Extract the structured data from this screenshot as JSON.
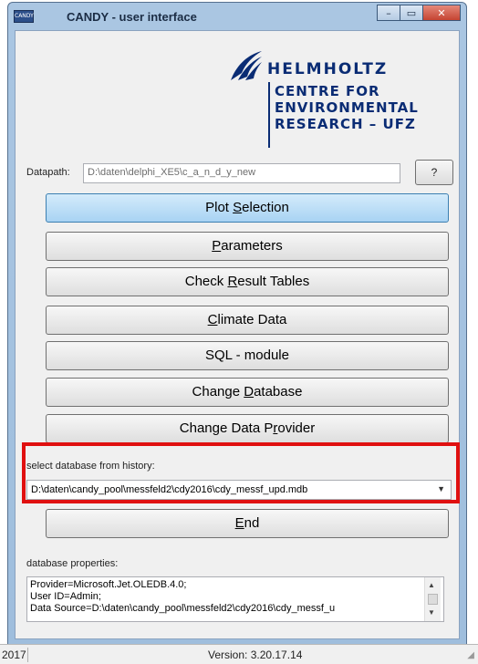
{
  "window": {
    "title": "CANDY  - user interface",
    "app_icon": "CANDY",
    "controls": {
      "minimize": "–",
      "maximize": "▭",
      "close": "✕"
    }
  },
  "logo": {
    "name": "HELMHOLTZ",
    "sub": [
      "CENTRE FOR",
      "ENVIRONMENTAL",
      "RESEARCH – UFZ"
    ],
    "brand_color": "#0a2c74"
  },
  "datapath": {
    "label": "Datapath:",
    "value": "D:\\daten\\delphi_XE5\\c_a_n_d_y_new",
    "help_label": "?"
  },
  "buttons": {
    "plot_selection": {
      "pre": "Plot ",
      "key": "S",
      "post": "election"
    },
    "parameters": {
      "pre": "",
      "key": "P",
      "post": "arameters"
    },
    "check_result_tables": {
      "pre": "Check ",
      "key": "R",
      "post": "esult Tables"
    },
    "climate_data": {
      "pre": "",
      "key": "C",
      "post": "limate Data"
    },
    "sql_module": {
      "pre": "SQL - module",
      "key": "",
      "post": ""
    },
    "change_database": {
      "pre": "Change  ",
      "key": "D",
      "post": "atabase"
    },
    "change_data_provider": {
      "pre": "Change Data P",
      "key": "r",
      "post": "ovider"
    },
    "end": {
      "pre": "",
      "key": "E",
      "post": "nd"
    }
  },
  "history": {
    "label": "select database from history:",
    "selected": "D:\\daten\\candy_pool\\messfeld2\\cdy2016\\cdy_messf_upd.mdb",
    "arrow": "▼"
  },
  "properties": {
    "label": "database properties:",
    "text": "Provider=Microsoft.Jet.OLEDB.4.0;\nUser ID=Admin;\nData Source=D:\\daten\\candy_pool\\messfeld2\\cdy2016\\cdy_messf_u"
  },
  "status": {
    "year": "2017",
    "version": "Version: 3.20.17.14"
  },
  "colors": {
    "highlight": "#e01010",
    "active_button": "#a8d3f3"
  }
}
